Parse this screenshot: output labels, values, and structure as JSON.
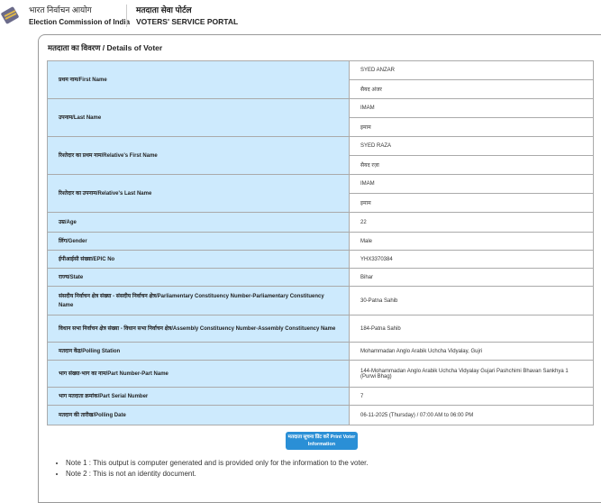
{
  "header": {
    "org_hi": "भारत निर्वाचन आयोग",
    "org_en": "Election Commission of India",
    "portal_hi": "मतदाता सेवा पोर्टल",
    "portal_en": "VOTERS' SERVICE PORTAL"
  },
  "card": {
    "title": "मतदाता का विवरण / Details of Voter"
  },
  "rows": [
    {
      "label": "प्रथम नाम/First Name",
      "values": [
        "SYED ANZAR",
        "सैयद अंजर"
      ]
    },
    {
      "label": "उपनाम/Last Name",
      "values": [
        "IMAM",
        "इमाम"
      ]
    },
    {
      "label": "रिश्तेदार का प्रथम नाम/Relative's First Name",
      "values": [
        "SYED RAZA",
        "सैयद रज़ा"
      ]
    },
    {
      "label": "रिश्तेदार का उपनाम/Relative's Last Name",
      "values": [
        "IMAM",
        "इमाम"
      ]
    },
    {
      "label": "उम्र/Age",
      "values": [
        "22"
      ]
    },
    {
      "label": "लिंग/Gender",
      "values": [
        "Male"
      ]
    },
    {
      "label": "ईपीआईसी संख्या/EPIC No",
      "values": [
        "YHX3370384"
      ]
    },
    {
      "label": "राज्य/State",
      "values": [
        "Bihar"
      ]
    },
    {
      "label": "संसदीय निर्वाचन क्षेत्र संख्या - संसदीय निर्वाचन क्षेत्र/Parliamentary Constituency Number-Parliamentary Constituency Name",
      "values": [
        "30-Patna Sahib"
      ]
    },
    {
      "label": "विधान सभा निर्वाचन क्षेत्र संख्या - विधान सभा निर्वाचन क्षेत्र/Assembly Constituency Number-Assembly Constituency Name",
      "values": [
        "184-Patna Sahib"
      ]
    },
    {
      "label": "मतदान केंद्र/Polling Station",
      "values": [
        "Mohammadan Anglo Arabik Uchcha Vidyalay, Gujri"
      ]
    },
    {
      "label": "भाग संख्या-भाग का नाम/Part Number-Part Name",
      "values": [
        "144-Mohammadan Anglo Arabik Uchcha Vidyalay Gujari Pashchimi Bhavan Sankhya 1 (Purwi Bhag)"
      ]
    },
    {
      "label": "भाग मतदाता क्रमांक/Part Serial Number",
      "values": [
        "7"
      ]
    },
    {
      "label": "मतदान की तारीख/Polling Date",
      "values": [
        "06-11-2025 (Thursday) / 07:00 AM to 06:00 PM"
      ]
    }
  ],
  "print_button": "मतदाता सूचना प्रिंट करें Print Voter Information",
  "notes": [
    "Note 1 : This output is computer generated and is provided only for the information to the voter.",
    "Note 2 : This is not an identity document."
  ]
}
